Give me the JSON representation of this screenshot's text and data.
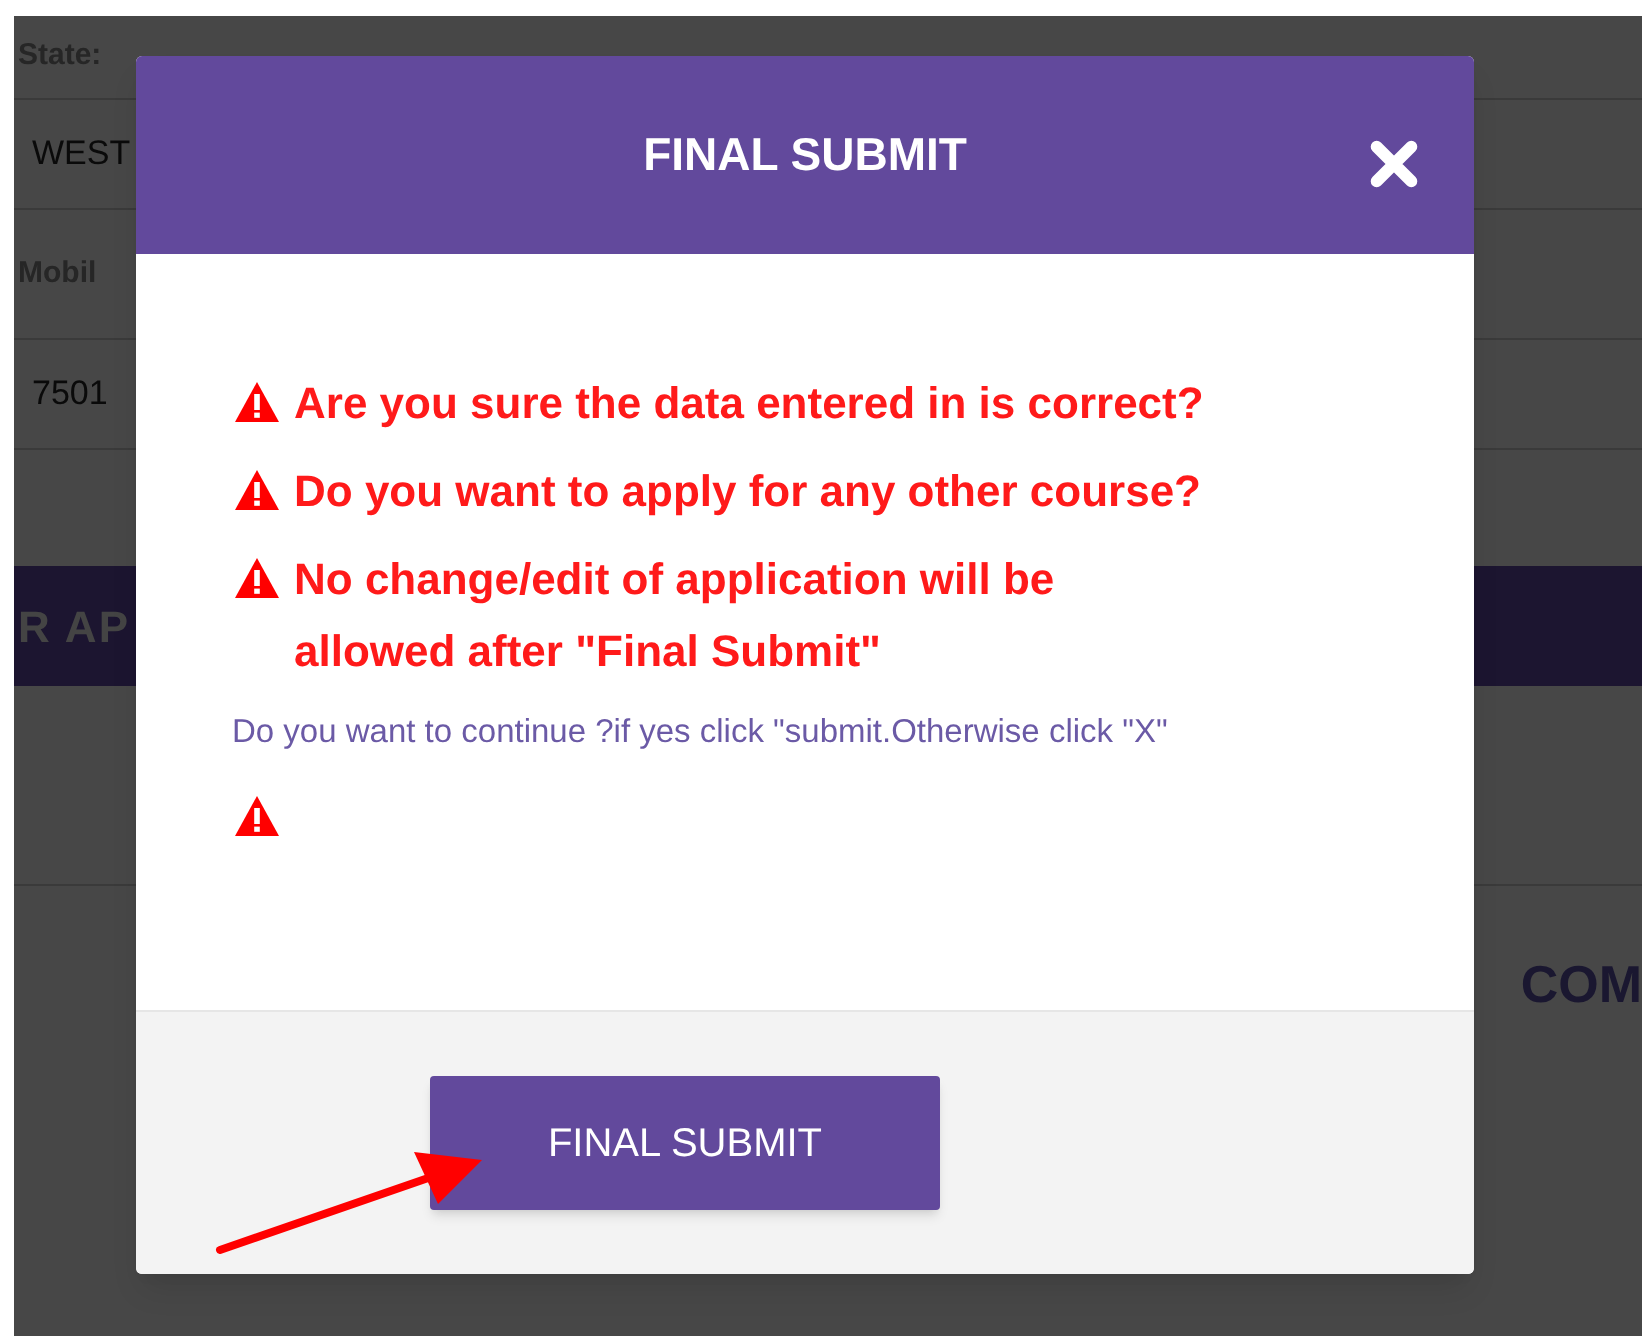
{
  "background": {
    "state_label": "State:",
    "state_value": "WEST",
    "mobile_label": "Mobil",
    "mobile_value": "7501",
    "banner": "R AP",
    "section_heading": "COM"
  },
  "dialog": {
    "title": "FINAL SUBMIT",
    "warnings": [
      "Are you sure the data entered in is correct?",
      "Do you want to apply for any other course?",
      "No change/edit of application will be allowed after \"Final Submit\""
    ],
    "note": "Do you want to continue ?if yes click \"submit.Otherwise click \"X\"",
    "button": "FINAL SUBMIT"
  }
}
